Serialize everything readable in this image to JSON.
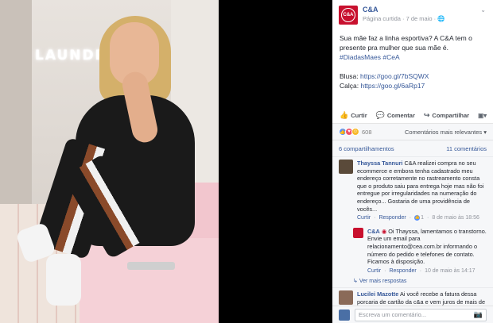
{
  "page": {
    "name": "C&A",
    "logo_text": "C&A",
    "meta": "Página curtida · 7 de maio ·"
  },
  "post": {
    "text1": "Sua mãe faz a linha esportiva? A C&A tem o presente pra mulher que sua mãe é. ",
    "hashtag1": "#DiadasMaes",
    "hashtag2": "#CeA",
    "blusa_label": "Blusa: ",
    "blusa_link": "https://goo.gl/7bSQWX",
    "calca_label": "Calça: ",
    "calca_link": "https://goo.gl/6aRp17",
    "photo_sign": "LAUNDRY"
  },
  "actions": {
    "like": "Curtir",
    "comment": "Comentar",
    "share": "Compartilhar"
  },
  "stats": {
    "reactions_count": "608",
    "relevance": "Comentários mais relevantes",
    "shares": "6 compartilhamentos",
    "comments": "11 comentários"
  },
  "comments": [
    {
      "name": "Thayssa Tannuri",
      "text": "C&A realizei compra no seu ecommerce e embora tenha cadastrado meu endereço corretamente no rastreamento consta que o produto saiu para entrega hoje mas não foi entregue por irregularidades na numeração do endereço... Gostaria de uma providência de vocês...",
      "like": "Curtir",
      "reply": "Responder",
      "likes": "1",
      "date": "8 de maio às 18:56",
      "avatar_color": "#5a4a3a"
    }
  ],
  "reply": {
    "name": "C&A",
    "text": "Oi Thayssa, lamentamos o transtorno. Envie um email para relacionamento@cea.com.br informando o número do pedido e telefones de contato. Ficamos à disposição.",
    "like": "Curtir",
    "reply": "Responder",
    "date": "10 de maio às 14:17",
    "more": "Ver mais respostas"
  },
  "comment2": {
    "name": "Lucilei Mazotte",
    "text": "Ai você recebe a fatura dessa porcaria de cartão da c&a e vem juros de mais de R$300,00! Nisso liga na central e a própria"
  },
  "composer": {
    "placeholder": "Escreva um comentário..."
  },
  "colors": {
    "brand": "#c8102e",
    "link": "#365899"
  }
}
